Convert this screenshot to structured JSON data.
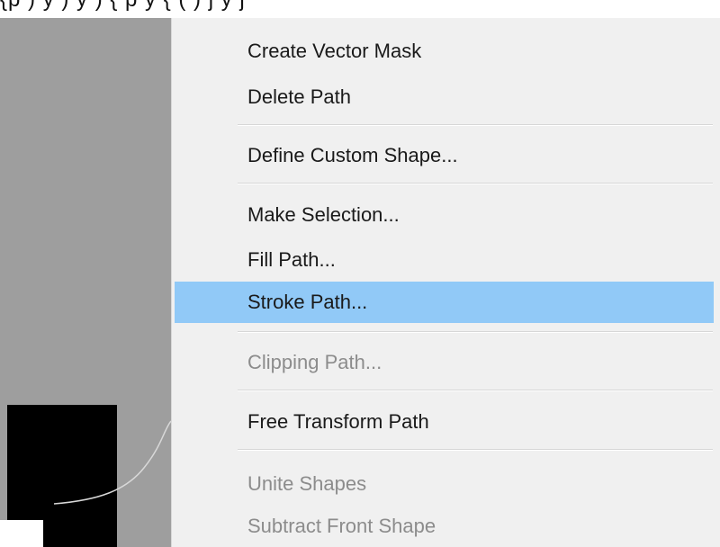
{
  "top_strip": {
    "text": "{p  )  y         )      y  )  {    p  y  {  (       ) j  y  j   "
  },
  "menu": {
    "items": [
      {
        "label": "Create Vector Mask",
        "enabled": true
      },
      {
        "label": "Delete Path",
        "enabled": true
      },
      {
        "label": "Define Custom Shape...",
        "enabled": true
      },
      {
        "label": "Make Selection...",
        "enabled": true
      },
      {
        "label": "Fill Path...",
        "enabled": true
      },
      {
        "label": "Stroke Path...",
        "enabled": true,
        "highlighted": true
      },
      {
        "label": "Clipping Path...",
        "enabled": false
      },
      {
        "label": "Free Transform Path",
        "enabled": true
      },
      {
        "label": "Unite Shapes",
        "enabled": false
      },
      {
        "label": "Subtract Front Shape",
        "enabled": false
      }
    ]
  },
  "colors": {
    "menu_background": "#f0f0f0",
    "highlight": "#91c9f7",
    "disabled_text": "#8c8c8c",
    "canvas_gray": "#9e9e9e"
  }
}
